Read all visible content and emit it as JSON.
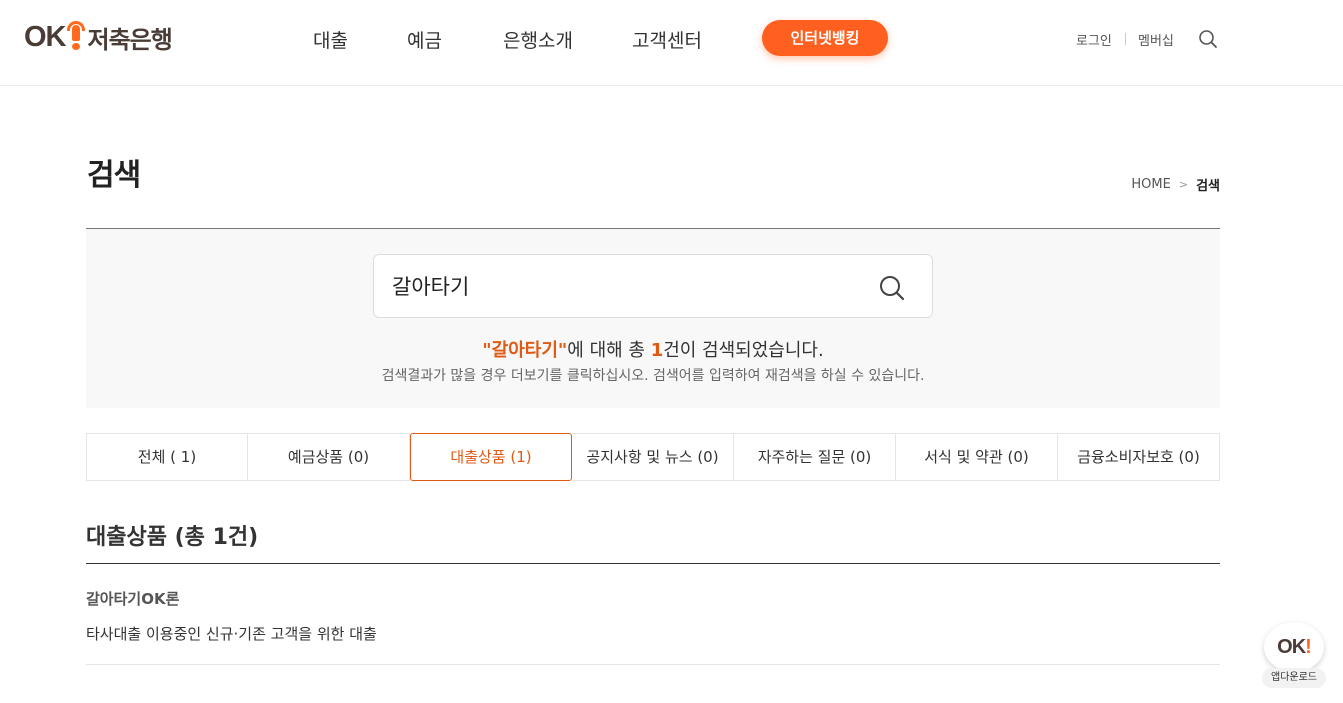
{
  "header": {
    "logo": {
      "ok": "OK",
      "text": "저축은행"
    },
    "nav": [
      {
        "label": "대출"
      },
      {
        "label": "예금"
      },
      {
        "label": "은행소개"
      },
      {
        "label": "고객센터"
      }
    ],
    "internet_banking": "인터넷뱅킹",
    "login": "로그인",
    "membership": "멤버십",
    "search_icon": "search-icon"
  },
  "page": {
    "title": "검색",
    "breadcrumb": {
      "home": "HOME",
      "sep": ">",
      "current": "검색"
    }
  },
  "search": {
    "value": "갈아타기",
    "result_keyword": "\"갈아타기\"",
    "result_mid": "에 대해 총 ",
    "result_count": "1",
    "result_tail": "건이 검색되었습니다.",
    "hint": "검색결과가 많을 경우 더보기를 클릭하십시오. 검색어를 입력하여 재검색을 하실 수 있습니다."
  },
  "tabs": [
    {
      "label": "전체 ( 1)",
      "active": false
    },
    {
      "label": "예금상품 (0)",
      "active": false
    },
    {
      "label": "대출상품 (1)",
      "active": true
    },
    {
      "label": "공지사항 및 뉴스 (0)",
      "active": false
    },
    {
      "label": "자주하는 질문 (0)",
      "active": false
    },
    {
      "label": "서식 및 약관 (0)",
      "active": false
    },
    {
      "label": "금융소비자보호 (0)",
      "active": false
    }
  ],
  "results": {
    "section_title": "대출상품 (총 1건)",
    "items": [
      {
        "title": "갈아타기OK론",
        "desc": "타사대출 이용중인 신규·기존 고객을 위한 대출"
      }
    ]
  },
  "app_download": {
    "logo": "OK",
    "logo_mark": "!",
    "label": "앱다운로드"
  },
  "colors": {
    "accent": "#ff5f1f",
    "highlight": "#e05a14",
    "brand_dark": "#4a3c36"
  }
}
